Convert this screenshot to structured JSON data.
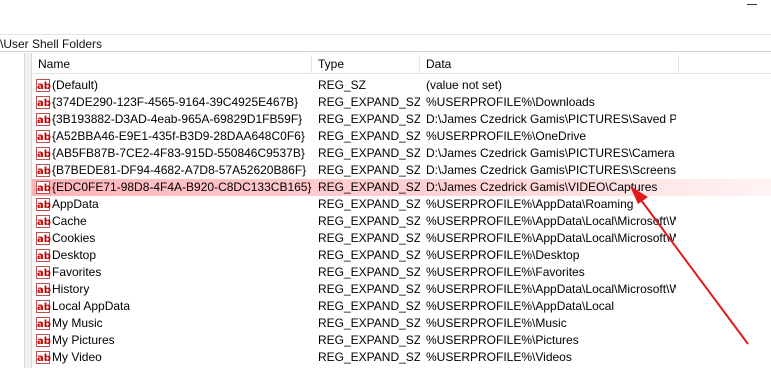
{
  "window": {
    "address": "\\User Shell Folders"
  },
  "columns": {
    "name": "Name",
    "type": "Type",
    "data": "Data"
  },
  "rows": [
    {
      "name": "(Default)",
      "type": "REG_SZ",
      "data": "(value not set)"
    },
    {
      "name": "{374DE290-123F-4565-9164-39C4925E467B}",
      "type": "REG_EXPAND_SZ",
      "data": "%USERPROFILE%\\Downloads"
    },
    {
      "name": "{3B193882-D3AD-4eab-965A-69829D1FB59F}",
      "type": "REG_EXPAND_SZ",
      "data": "D:\\James Czedrick Gamis\\PICTURES\\Saved Pictures"
    },
    {
      "name": "{A52BBA46-E9E1-435f-B3D9-28DAA648C0F6}",
      "type": "REG_EXPAND_SZ",
      "data": "%USERPROFILE%\\OneDrive"
    },
    {
      "name": "{AB5FB87B-7CE2-4F83-915D-550846C9537B}",
      "type": "REG_EXPAND_SZ",
      "data": "D:\\James Czedrick Gamis\\PICTURES\\Camera Roll"
    },
    {
      "name": "{B7BEDE81-DF94-4682-A7D8-57A52620B86F}",
      "type": "REG_EXPAND_SZ",
      "data": "D:\\James Czedrick Gamis\\PICTURES\\Screenshots"
    },
    {
      "name": "{EDC0FE71-98D8-4F4A-B920-C8DC133CB165}",
      "type": "REG_EXPAND_SZ",
      "data": "D:\\James Czedrick Gamis\\VIDEO\\Captures"
    },
    {
      "name": "AppData",
      "type": "REG_EXPAND_SZ",
      "data": "%USERPROFILE%\\AppData\\Roaming"
    },
    {
      "name": "Cache",
      "type": "REG_EXPAND_SZ",
      "data": "%USERPROFILE%\\AppData\\Local\\Microsoft\\Wind..."
    },
    {
      "name": "Cookies",
      "type": "REG_EXPAND_SZ",
      "data": "%USERPROFILE%\\AppData\\Local\\Microsoft\\Wind..."
    },
    {
      "name": "Desktop",
      "type": "REG_EXPAND_SZ",
      "data": "%USERPROFILE%\\Desktop"
    },
    {
      "name": "Favorites",
      "type": "REG_EXPAND_SZ",
      "data": "%USERPROFILE%\\Favorites"
    },
    {
      "name": "History",
      "type": "REG_EXPAND_SZ",
      "data": "%USERPROFILE%\\AppData\\Local\\Microsoft\\Wind..."
    },
    {
      "name": "Local AppData",
      "type": "REG_EXPAND_SZ",
      "data": "%USERPROFILE%\\AppData\\Local"
    },
    {
      "name": "My Music",
      "type": "REG_EXPAND_SZ",
      "data": "%USERPROFILE%\\Music"
    },
    {
      "name": "My Pictures",
      "type": "REG_EXPAND_SZ",
      "data": "%USERPROFILE%\\Pictures"
    },
    {
      "name": "My Video",
      "type": "REG_EXPAND_SZ",
      "data": "%USERPROFILE%\\Videos"
    }
  ],
  "selected_row_index": 6,
  "icons": {
    "row_icon": "registry-string-value-icon",
    "window_button": "minimize-icon",
    "annotation": "red-arrow-icon"
  },
  "colors": {
    "highlight": "#ff8a92",
    "arrow": "#e01b1b",
    "icon_red": "#c00000"
  }
}
